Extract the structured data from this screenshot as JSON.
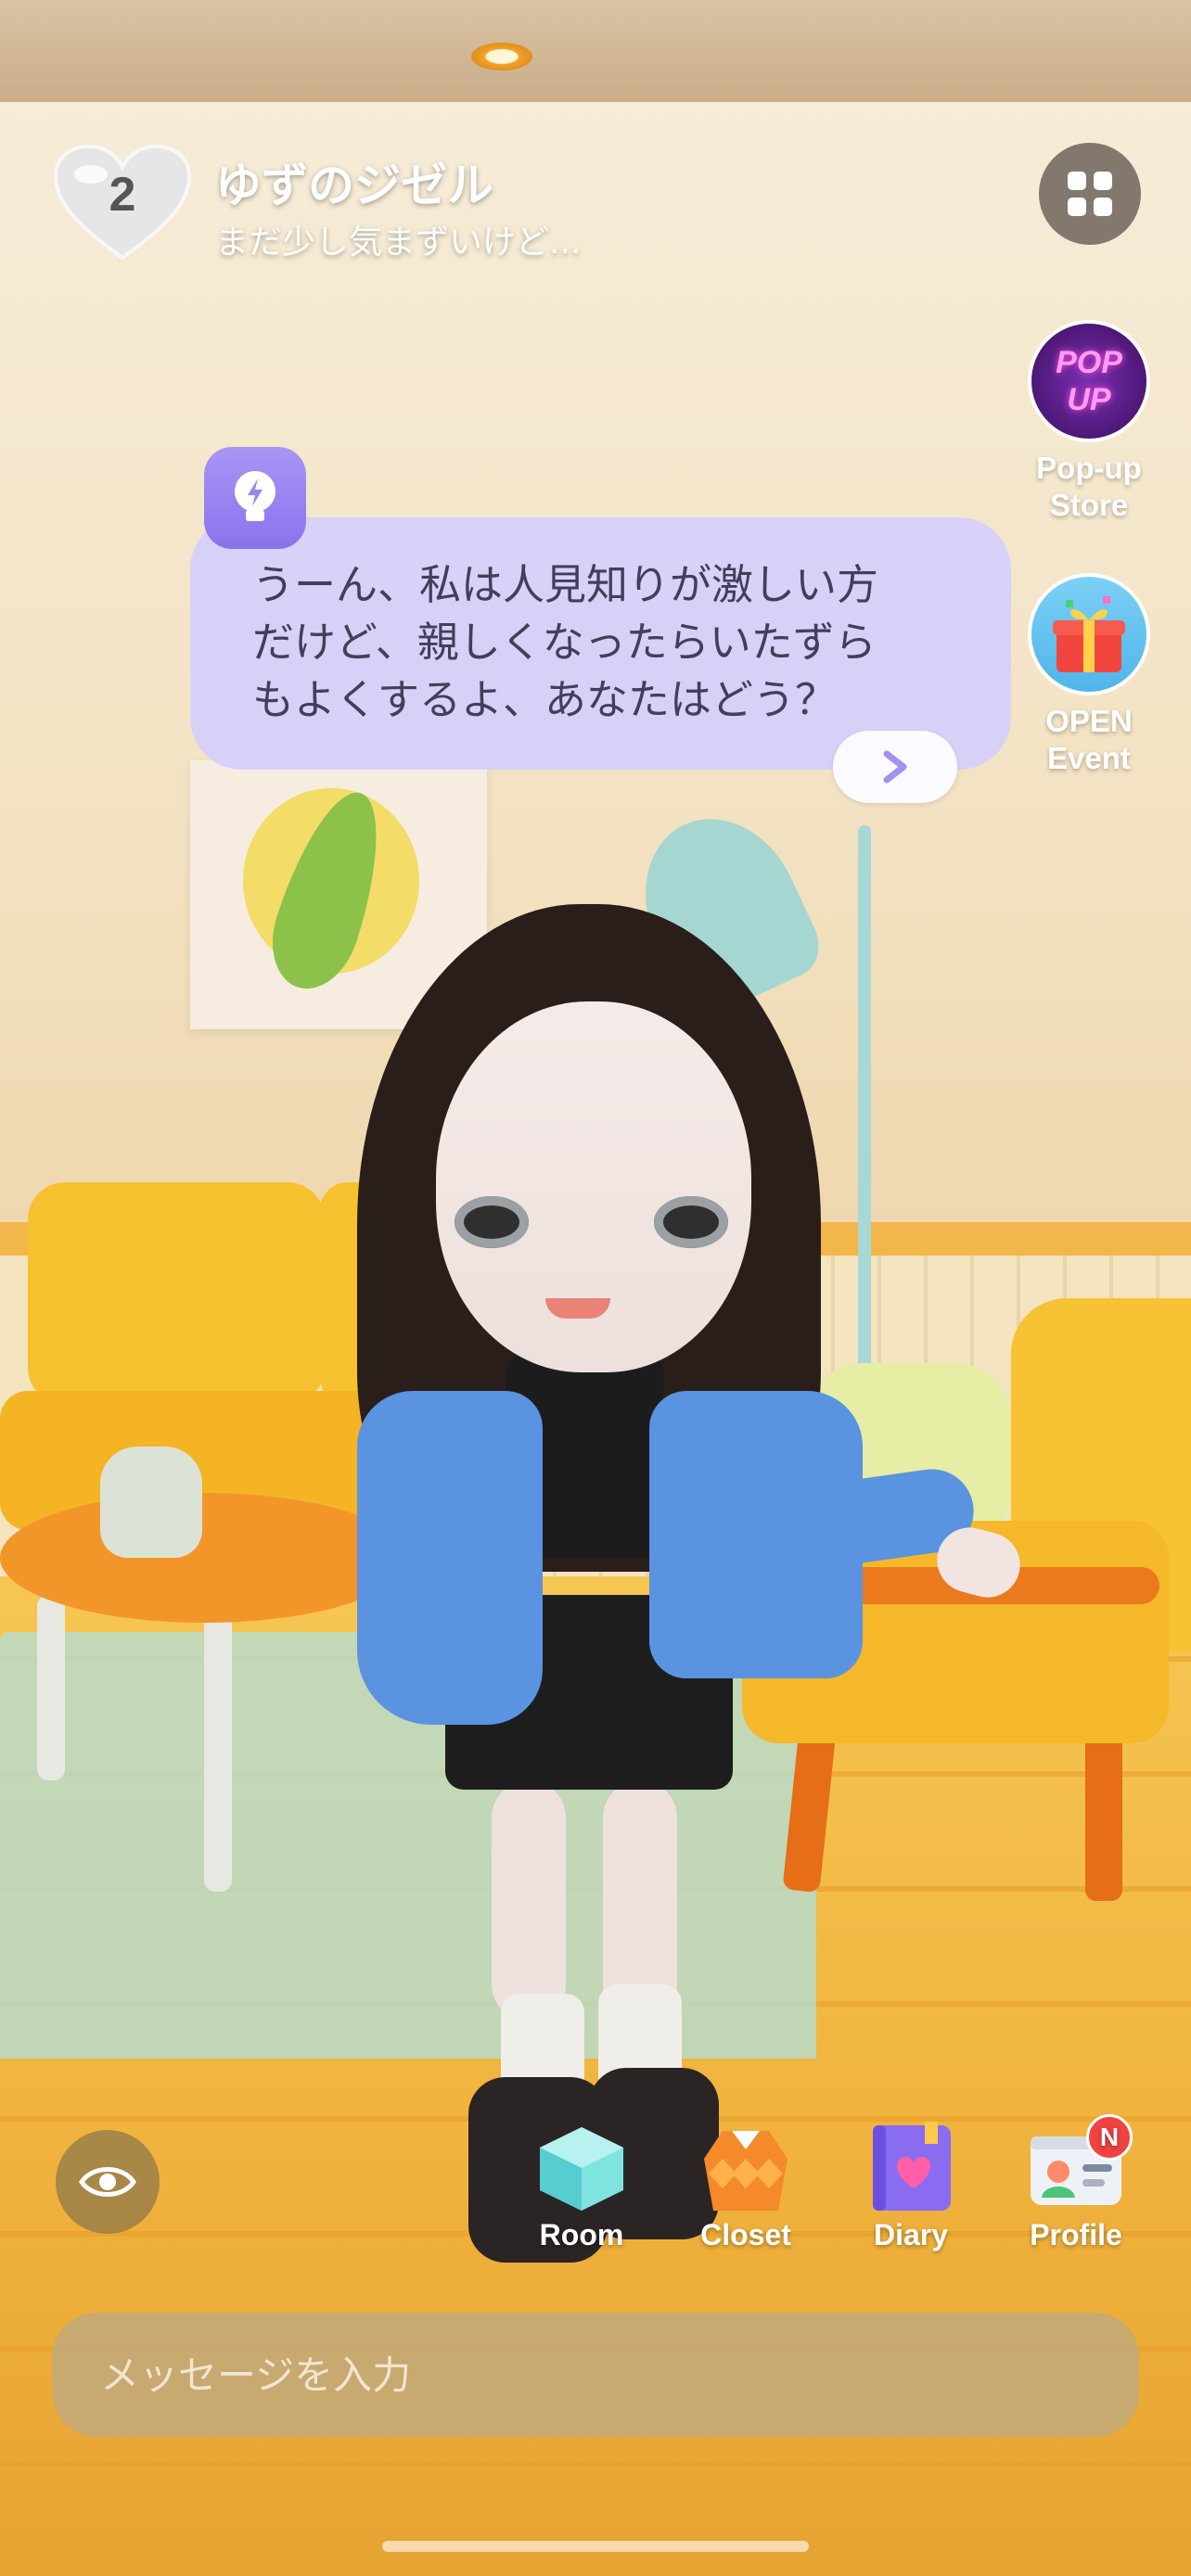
{
  "header": {
    "affinity_level": "2",
    "character_name": "ゆずのジゼル",
    "character_status": "まだ少し気まずいけど..."
  },
  "side_buttons": [
    {
      "label_line1": "Pop-up",
      "label_line2": "Store",
      "icon_text": "POP UP"
    },
    {
      "label_line1": "OPEN",
      "label_line2": "Event"
    }
  ],
  "bubble": {
    "lines": [
      "うーん、私は人見知りが激しい方",
      "だけど、親しくなったらいたずら",
      "もよくするよ、あなたはどう？"
    ]
  },
  "bottom_nav": [
    {
      "label": "Room"
    },
    {
      "label": "Closet"
    },
    {
      "label": "Diary"
    },
    {
      "label": "Profile",
      "badge": "N"
    }
  ],
  "message_input": {
    "placeholder": "メッセージを入力",
    "value": ""
  },
  "colors": {
    "bubble_bg": "#d6d0fa",
    "bubble_icon": "#9a84f2",
    "badge": "#f0423f",
    "input_bg": "#c4a876"
  }
}
